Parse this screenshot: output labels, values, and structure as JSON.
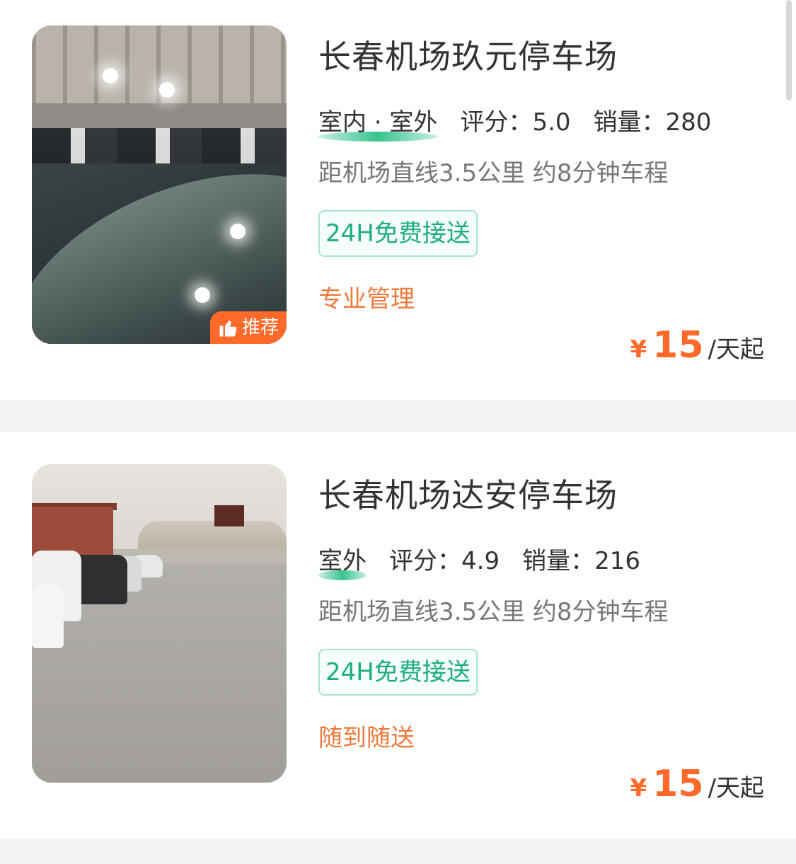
{
  "listings": [
    {
      "title": "长春机场玖元停车场",
      "type": "室内 · 室外",
      "rating_label": "评分：",
      "rating": "5.0",
      "sales_label": "销量：",
      "sales": "280",
      "distance": "距机场直线3.5公里 约8分钟车程",
      "tag": "24H免费接送",
      "feature": "专业管理",
      "currency": "¥",
      "price": "15",
      "price_unit": "/天起",
      "badge": "推荐",
      "badge_icon": "thumbs-up-icon"
    },
    {
      "title": "长春机场达安停车场",
      "type": "室外",
      "rating_label": "评分：",
      "rating": "4.9",
      "sales_label": "销量：",
      "sales": "216",
      "distance": "距机场直线3.5公里 约8分钟车程",
      "tag": "24H免费接送",
      "feature": "随到随送",
      "currency": "¥",
      "price": "15",
      "price_unit": "/天起"
    }
  ],
  "colors": {
    "accent_orange": "#ff6a2a",
    "tag_green": "#1fae7a",
    "feature_orange": "#f07a3c",
    "separator": "#f4f4f4"
  }
}
